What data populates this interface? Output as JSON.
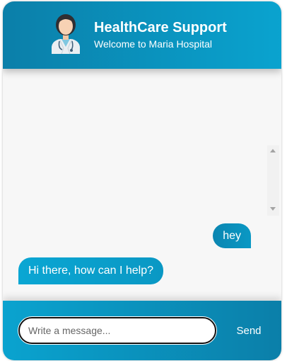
{
  "header": {
    "title": "HealthCare Support",
    "subtitle": "Welcome to Maria Hospital",
    "avatar_icon": "doctor-avatar-icon"
  },
  "messages": [
    {
      "sender": "user",
      "text": "hey"
    },
    {
      "sender": "bot",
      "text": "Hi there, how can I help?"
    }
  ],
  "composer": {
    "placeholder": "Write a message...",
    "value": "",
    "send_label": "Send"
  },
  "colors": {
    "header_gradient_start": "#0b7fa9",
    "header_gradient_end": "#0aa3cf",
    "bubble": "#0a98c4",
    "background": "#f7f7f7"
  }
}
